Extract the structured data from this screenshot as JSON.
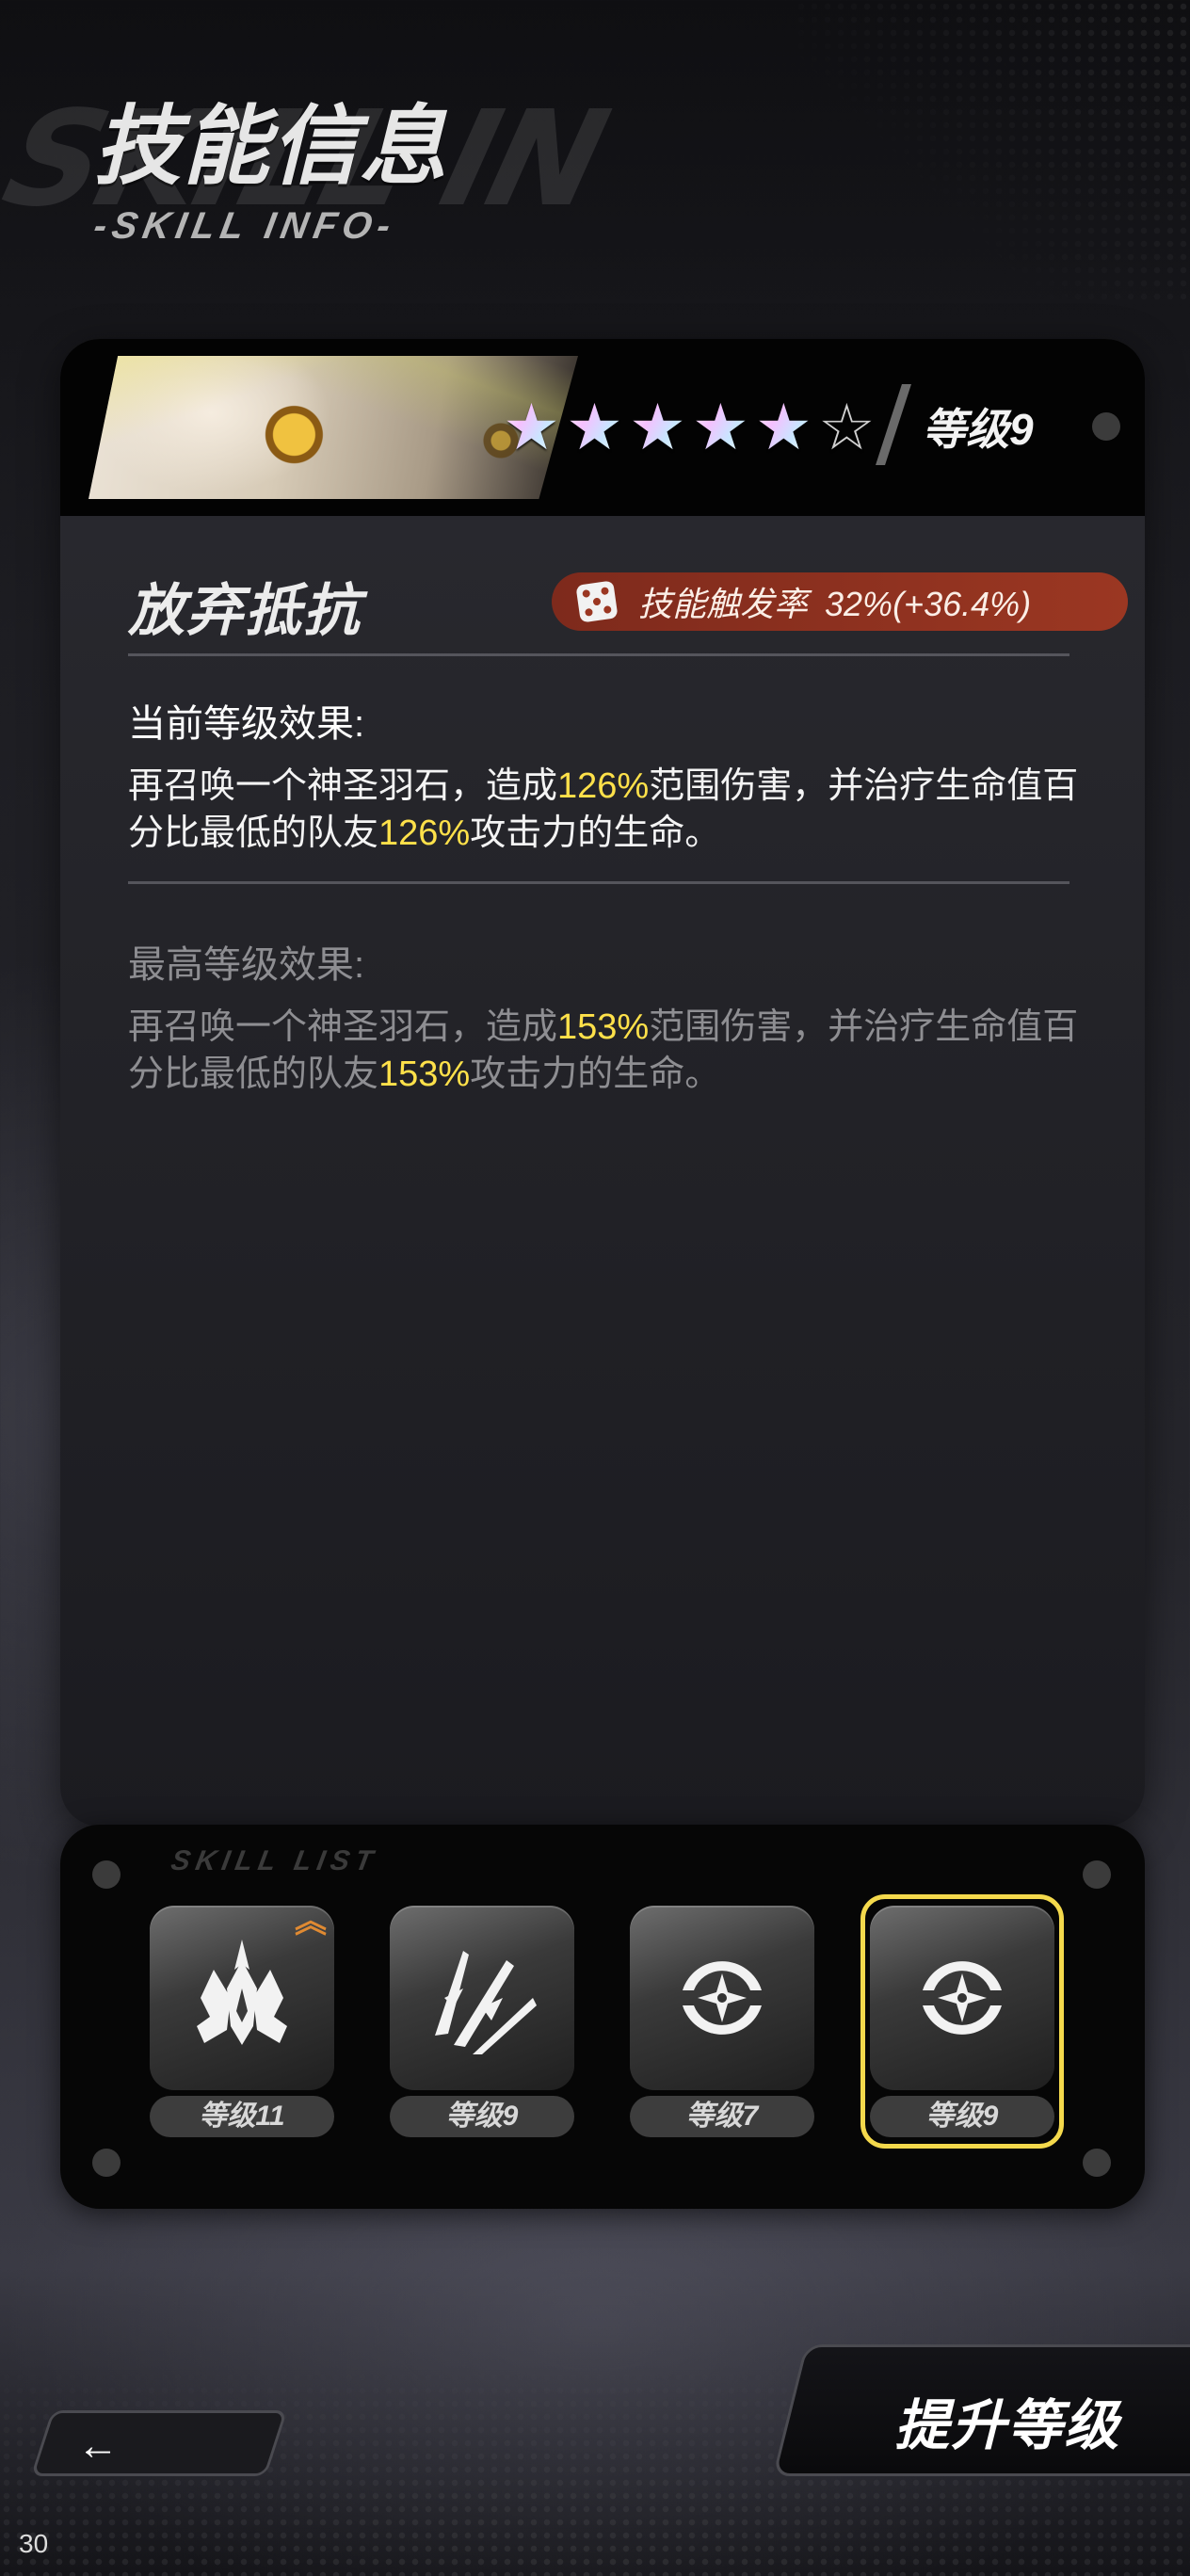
{
  "header": {
    "title": "技能信息",
    "subtitle": "-SKILL INFO-",
    "bg_word": "SKILL IN"
  },
  "card": {
    "stars": [
      "★",
      "★",
      "★",
      "★",
      "★",
      "☆"
    ],
    "stars_filled": 5,
    "stars_total": 6,
    "level_label": "等级9"
  },
  "skill": {
    "name": "放弃抵抗",
    "trigger_label": "技能触发率",
    "trigger_value": "32%(+36.4%)"
  },
  "current": {
    "title": "当前等级效果:",
    "desc_1": "再召唤一个神圣羽石，造成",
    "desc_hl_1": "126%",
    "desc_2": "范围伤害，并治疗生命值百分比最低的队友",
    "desc_hl_2": "126%",
    "desc_3": "攻击力的生命。"
  },
  "max": {
    "title": "最高等级效果:",
    "desc_1": "再召唤一个神圣羽石，造成",
    "desc_hl_1": "153%",
    "desc_2": "范围伤害，并治疗生命值百分比最低的队友",
    "desc_hl_2": "153%",
    "desc_3": "攻击力的生命。"
  },
  "skill_list": {
    "watermark": "SKILL LIST",
    "slots": [
      {
        "level": "等级11",
        "icon": "crown-spike-icon",
        "upgradable": true
      },
      {
        "level": "等级9",
        "icon": "feather-claw-icon",
        "upgradable": false
      },
      {
        "level": "等级7",
        "icon": "cross-ring-icon",
        "upgradable": false
      },
      {
        "level": "等级9",
        "icon": "cross-ring-icon",
        "upgradable": false,
        "selected": true
      }
    ],
    "up_icon": "︽"
  },
  "buttons": {
    "back_icon": "←",
    "upgrade": "提升等级"
  },
  "page_number": "30",
  "colors": {
    "highlight": "#ffe14a",
    "badge": "#9b3722",
    "selected_frame": "#f4d94c"
  }
}
